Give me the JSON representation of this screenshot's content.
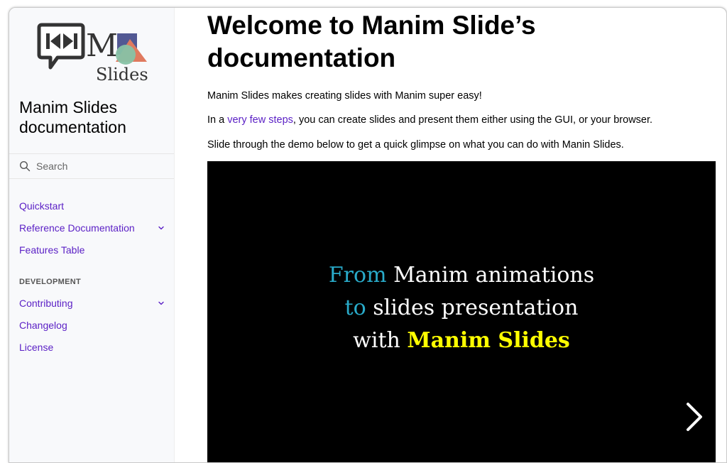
{
  "sidebar": {
    "logo_text": "Slides",
    "site_title": "Manim Slides documentation",
    "search_placeholder": "Search",
    "nav": [
      {
        "label": "Quickstart",
        "expandable": false
      },
      {
        "label": "Reference Documentation",
        "expandable": true
      },
      {
        "label": "Features Table",
        "expandable": false
      }
    ],
    "caption": "DEVELOPMENT",
    "dev_nav": [
      {
        "label": "Contributing",
        "expandable": true
      },
      {
        "label": "Changelog",
        "expandable": false
      },
      {
        "label": "License",
        "expandable": false
      }
    ]
  },
  "main": {
    "title": "Welcome to Manim Slide’s documentation",
    "intro": "Manim Slides makes creating slides with Manim super easy!",
    "steps_prefix": "In a ",
    "steps_link": "very few steps",
    "steps_suffix": ", you can create slides and present them either using the GUI, or your browser.",
    "demo_intro": "Slide through the demo below to get a quick glimpse on what you can do with Manin Slides.",
    "demo": {
      "line1_a": "From",
      "line1_b": " Manim animations",
      "line2_a": "to",
      "line2_b": " slides presentation",
      "line3_a": "with ",
      "line3_b": "Manim Slides"
    }
  },
  "colors": {
    "link": "#5a1fc5",
    "demo_blue": "#29abca",
    "demo_yellow": "#ffff00",
    "sidebar_bg": "#f8f9fb"
  },
  "icons": {
    "search": "search-icon",
    "chevron": "chevron-down-icon",
    "next": "chevron-right-icon"
  }
}
